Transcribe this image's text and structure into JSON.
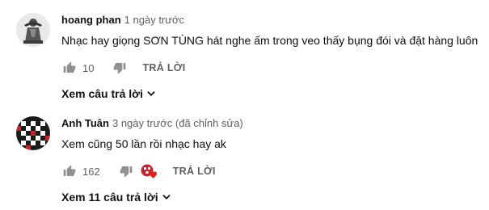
{
  "comments": [
    {
      "author": "hoang phan",
      "time": "1 ngày trước",
      "text": "Nhạc hay giọng SƠN TÙNG hát nghe ấm trong veo thấy bụng đói và đặt hàng luôn",
      "likes": "10",
      "reply_label": "TRẢ LỜI",
      "view_replies": "Xem câu trả lời"
    },
    {
      "author": "Anh Tuân",
      "time": "3 ngày trước (đã chỉnh sửa)",
      "text": "Xem cũng 50 lần rồi nhạc hay ak",
      "likes": "162",
      "reply_label": "TRẢ LỜI",
      "view_replies": "Xem 11 câu trả lời"
    }
  ],
  "colors": {
    "heart": "#e62117",
    "icon": "#909090",
    "muted": "#606060"
  }
}
